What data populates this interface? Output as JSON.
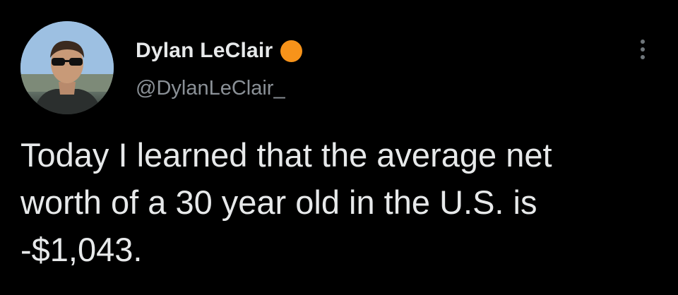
{
  "author": {
    "display_name": "Dylan LeClair",
    "handle": "@DylanLeClair_",
    "badge_color": "#f7931a",
    "avatar_icon": "profile-photo"
  },
  "menu": {
    "icon": "more-options-icon"
  },
  "tweet": {
    "lines": [
      "Today I learned that the average net",
      "worth of a 30 year old in the U.S. is",
      "-$1,043."
    ]
  },
  "colors": {
    "background": "#000000",
    "text": "#e7e9ea",
    "secondary_text": "#8b9197"
  }
}
